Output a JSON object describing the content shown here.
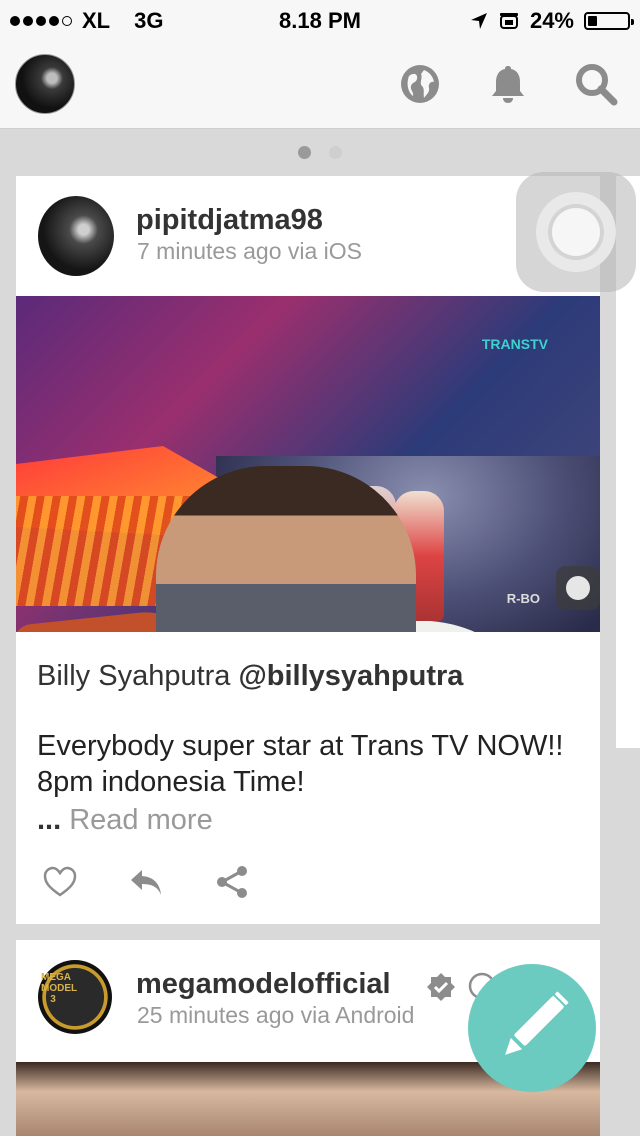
{
  "status_bar": {
    "carrier": "XL",
    "network": "3G",
    "time": "8.18 PM",
    "battery": "24%",
    "battery_level": 0.24,
    "signal_bars": 4
  },
  "nav": {
    "icons": [
      "globe-icon",
      "bell-icon",
      "search-icon"
    ]
  },
  "pager": {
    "pages": 2,
    "active": 1
  },
  "posts": [
    {
      "username": "pipitdjatma98",
      "meta": "7 minutes ago via iOS",
      "caption_name": "Billy Syahputra ",
      "caption_handle": "@billysyahputra",
      "body": "Everybody super star at Trans TV NOW!! 8pm indonesia Time!",
      "ellipsis": "...",
      "read_more": "Read more",
      "image_text_tv": "TRANSTV",
      "image_text_corner": "R-BO"
    },
    {
      "username": "megamodelofficial",
      "meta": "25 minutes ago via Android",
      "avatar_text": "MEGA MODEL 3"
    }
  ],
  "colors": {
    "fab": "#6bcbc0",
    "background": "#d9d9d9"
  }
}
